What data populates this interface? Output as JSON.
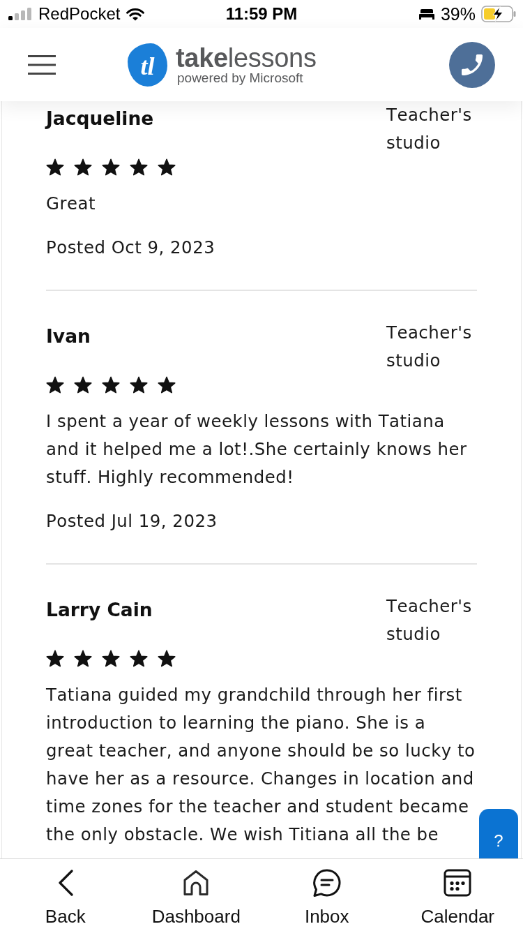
{
  "status_bar": {
    "carrier": "RedPocket",
    "time": "11:59 PM",
    "battery": "39%"
  },
  "header": {
    "logo_mark": "tl",
    "logo_name": "**take**lessons",
    "logo_tagline": "powered by Microsoft"
  },
  "reviews": [
    {
      "name": "Jacqueline",
      "source": "Teacher's studio",
      "stars": 5,
      "text": "Great",
      "date": "Posted Oct 9, 2023"
    },
    {
      "name": "Ivan",
      "source": "Teacher's studio",
      "stars": 5,
      "text": "I spent a year of weekly lessons with Tatiana and it helped me a lot!.She certainly knows her stuff. Highly recommended!",
      "date": "Posted Jul 19, 2023"
    },
    {
      "name": "Larry Cain",
      "source": "Teacher's studio",
      "stars": 5,
      "text": "Tatiana guided my grandchild through her first introduction to learning the piano. She is a great teacher, and anyone should be so lucky to have her as a resource. Changes in location and time zones for the teacher and student became the only obstacle. We wish Titiana all the be"
    }
  ],
  "help_button": {
    "label": "?"
  },
  "tab_bar": {
    "items": [
      {
        "label": "Back"
      },
      {
        "label": "Dashboard"
      },
      {
        "label": "Inbox"
      },
      {
        "label": "Calendar"
      }
    ]
  }
}
